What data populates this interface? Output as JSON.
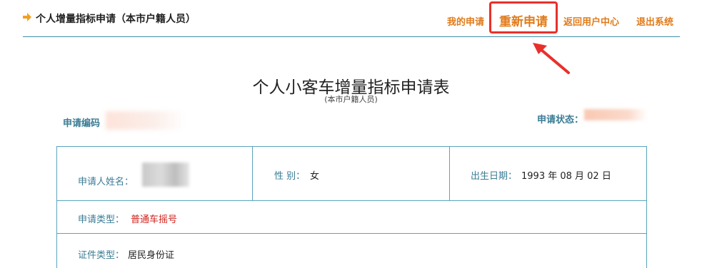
{
  "header": {
    "title": "个人增量指标申请（本市户籍人员）",
    "nav": {
      "my_application": "我的申请",
      "reapply": "重新申请",
      "return_user_center": "返回用户中心",
      "logout": "退出系统"
    }
  },
  "form": {
    "title": "个人小客车增量指标申请表",
    "subtitle": "(本市户籍人员)",
    "application_no_label": "申请编码",
    "status_label": "申请状态：",
    "applicant_name_label": "申请人姓名：",
    "gender_label": "性 别：",
    "gender_value": "女",
    "birth_label": "出生日期：",
    "birth_value": "1993 年 08 月 02 日",
    "apply_type_label": "申请类型：",
    "apply_type_value": "普通车摇号",
    "id_type_label": "证件类型：",
    "id_type_value": "居民身份证"
  },
  "colors": {
    "nav_orange": "#e07b1a",
    "highlight_red": "#e8302a",
    "table_border": "#5aa3bd",
    "label_blue": "#3a7c95",
    "value_red": "#d0201a"
  }
}
